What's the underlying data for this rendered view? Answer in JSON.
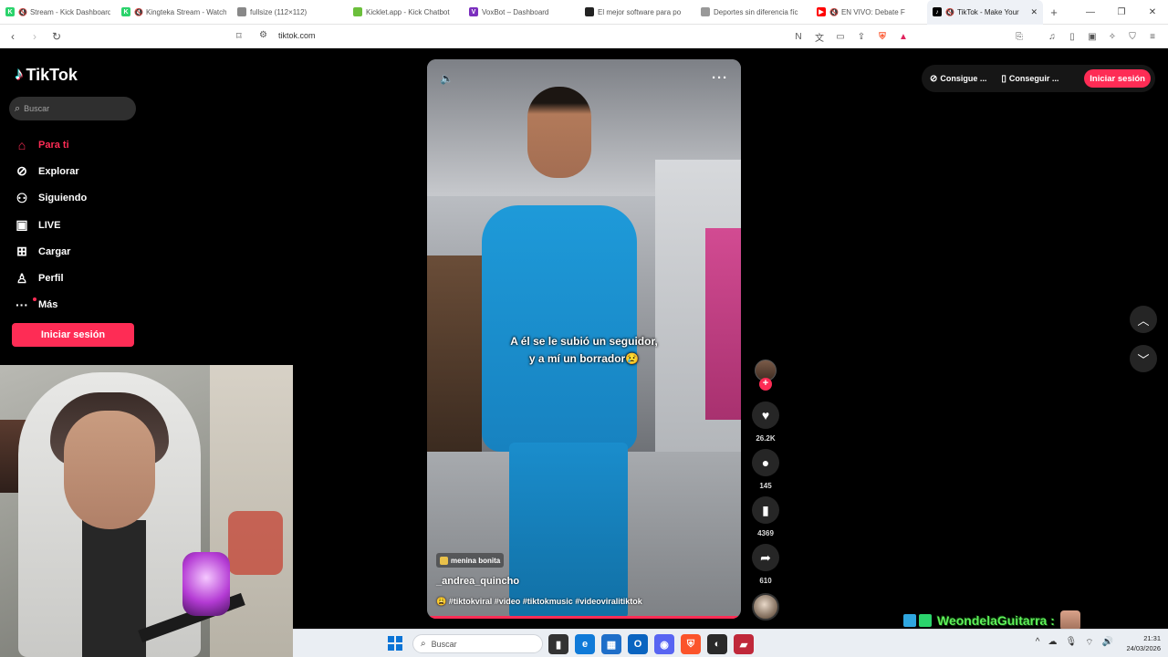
{
  "browser": {
    "tabs": [
      {
        "title": "Stream - Kick Dashboard",
        "fav_color": "#2bd36c",
        "fav_glyph": "K",
        "muted": true
      },
      {
        "title": "Kingteka Stream - Watch",
        "fav_color": "#2bd36c",
        "fav_glyph": "K",
        "muted": true
      },
      {
        "title": "fullsize (112×112)",
        "fav_color": "#888888",
        "fav_glyph": "",
        "muted": false
      },
      {
        "title": "Kicklet.app - Kick Chatbot",
        "fav_color": "#6bbf3b",
        "fav_glyph": "",
        "muted": false
      },
      {
        "title": "VoxBot – Dashboard",
        "fav_color": "#7b2fbe",
        "fav_glyph": "V",
        "muted": false
      },
      {
        "title": "El mejor software para po",
        "fav_color": "#222222",
        "fav_glyph": "",
        "muted": false
      },
      {
        "title": "Deportes sin diferencia fíc",
        "fav_color": "#999999",
        "fav_glyph": "",
        "muted": false
      },
      {
        "title": "EN VIVO: Debate F",
        "fav_color": "#ff0000",
        "fav_glyph": "▶",
        "muted": true
      },
      {
        "title": "TikTok - Make Your",
        "fav_color": "#000000",
        "fav_glyph": "♪",
        "muted": true,
        "active": true
      }
    ],
    "url": "tiktok.com"
  },
  "sidebar": {
    "logo": "TikTok",
    "search_placeholder": "Buscar",
    "items": [
      {
        "label": "Para ti",
        "icon": "home-icon",
        "active": true
      },
      {
        "label": "Explorar",
        "icon": "compass-icon"
      },
      {
        "label": "Siguiendo",
        "icon": "user-icon"
      },
      {
        "label": "LIVE",
        "icon": "live-icon"
      },
      {
        "label": "Cargar",
        "icon": "upload-icon"
      },
      {
        "label": "Perfil",
        "icon": "profile-icon"
      },
      {
        "label": "Más",
        "icon": "more-icon"
      }
    ],
    "login_label": "Iniciar sesión"
  },
  "topbar": {
    "link1": "Consigue ...",
    "link2": "Conseguir ...",
    "login_label": "Iniciar sesión"
  },
  "video": {
    "caption_line1": "A él se le subió un seguidor,",
    "caption_line2": "y a mí un borrador😢",
    "tag": "menina bonita",
    "author": "_andrea_quincho",
    "description": "😩 #tiktokviral #video #tiktokmusic #videoviralitiktok",
    "progress": 1.0
  },
  "actions": {
    "likes": "26.2K",
    "comments": "145",
    "saves": "4369",
    "shares": "610"
  },
  "overlay": {
    "streamer_name": "WeondelaGuitarra :"
  },
  "taskbar": {
    "search_label": "Buscar",
    "time": "21:31",
    "date": "24/03/2026"
  },
  "colors": {
    "accent": "#fe2c55",
    "background": "#000000"
  }
}
